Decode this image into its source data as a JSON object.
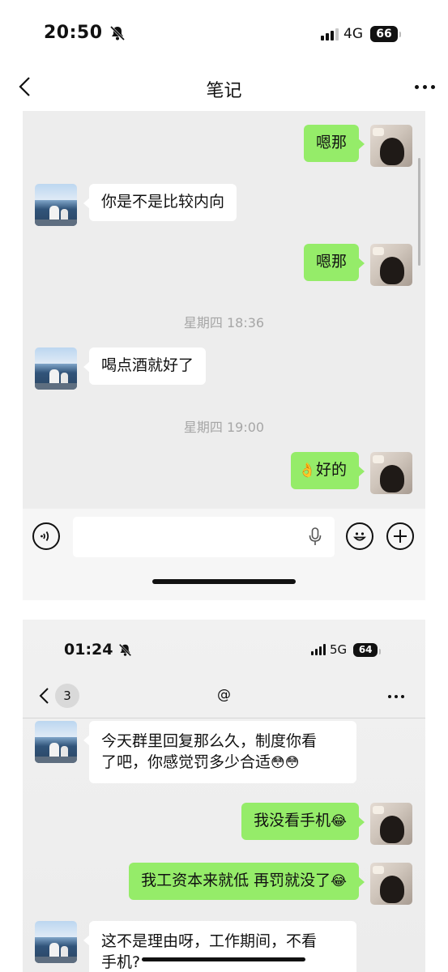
{
  "status_bar": {
    "time": "20:50",
    "network": "4G",
    "battery": "66"
  },
  "nav": {
    "title": "笔记"
  },
  "chat1": {
    "messages": [
      {
        "side": "right",
        "text": "嗯那"
      },
      {
        "side": "left",
        "text": "你是不是比较内向"
      },
      {
        "side": "right",
        "text": "嗯那"
      },
      {
        "type": "time",
        "text": "星期四 18:36"
      },
      {
        "side": "left",
        "text": "喝点酒就好了"
      },
      {
        "type": "time",
        "text": "星期四 19:00"
      },
      {
        "side": "right",
        "emoji": "👌",
        "text": "好的"
      }
    ]
  },
  "screenshot2": {
    "status_bar": {
      "time": "01:24",
      "network": "5G",
      "battery": "64"
    },
    "nav": {
      "back_count": "3",
      "title": "@"
    },
    "messages": [
      {
        "side": "left",
        "line1": "今天群里回复那么久，制度你看",
        "line2": "了吧，你感觉罚多少合适",
        "emoji": "😳😳"
      },
      {
        "side": "right",
        "text": "我没看手机",
        "emoji": "😂"
      },
      {
        "side": "right",
        "text": "我工资本来就低 再罚就没了",
        "emoji": "😂"
      },
      {
        "side": "left",
        "line1": "这不是理由呀，工作期间，不看",
        "line2": "手机?"
      }
    ]
  },
  "icons": {
    "back": "chevron-left-icon",
    "more": "more-dots-icon",
    "voice": "voice-input-icon",
    "mic": "mic-icon",
    "emoji": "emoji-icon",
    "plus": "plus-icon",
    "mute": "bell-slash-icon"
  }
}
